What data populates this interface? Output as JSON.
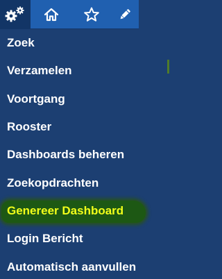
{
  "icon_bar": {
    "items": [
      {
        "icon": "gears-icon",
        "active": true
      },
      {
        "icon": "home-icon",
        "active": false
      },
      {
        "icon": "star-icon",
        "active": false
      },
      {
        "icon": "pencil-icon",
        "active": false
      }
    ]
  },
  "menu": {
    "items": [
      {
        "label": "Zoek"
      },
      {
        "label": "Verzamelen"
      },
      {
        "label": "Voortgang"
      },
      {
        "label": "Rooster"
      },
      {
        "label": "Dashboards beheren"
      },
      {
        "label": "Zoekopdrachten"
      },
      {
        "label": "Genereer Dashboard",
        "highlighted": true
      },
      {
        "label": "Login Bericht"
      },
      {
        "label": "Automatisch aanvullen"
      }
    ]
  },
  "colors": {
    "panel_background": "#1c3f72",
    "icon_bar_background": "#2060b0",
    "active_icon_background": "#123566",
    "menu_text": "#ffffff",
    "highlight_text": "#f2ff1a",
    "highlight_marker": "#1e5a10"
  }
}
